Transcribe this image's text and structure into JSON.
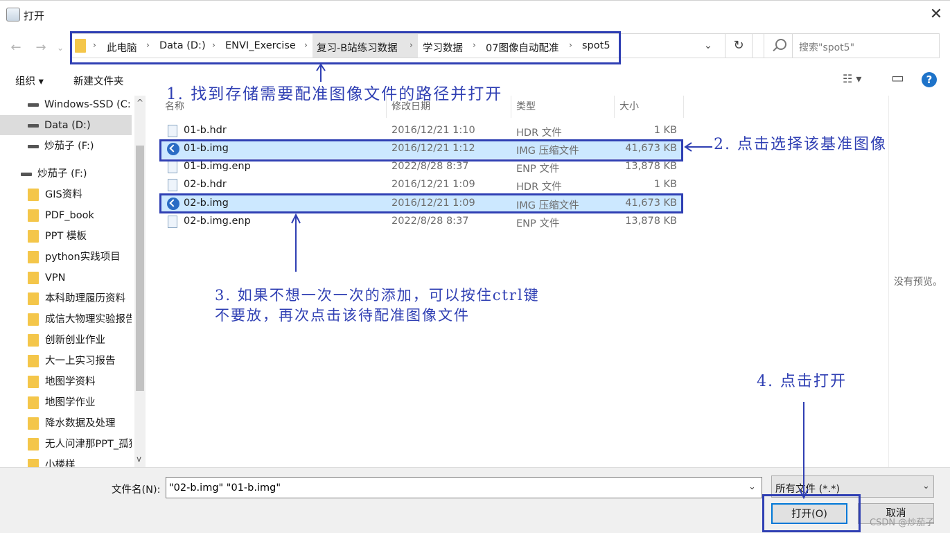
{
  "window": {
    "title": "打开",
    "close_glyph": "✕"
  },
  "nav": {
    "back_glyph": "←",
    "forward_glyph": "→"
  },
  "address": {
    "crumbs": [
      "此电脑",
      "Data (D:)",
      "ENVI_Exercise",
      "复习-B站练习数据",
      "学习数据",
      "07图像自动配准",
      "spot5"
    ],
    "separator": "›",
    "dropdown_glyph": "⌄",
    "refresh_glyph": "↻"
  },
  "search": {
    "placeholder": "搜索\"spot5\""
  },
  "toolbar": {
    "organize": "组织 ▾",
    "new_folder": "新建文件夹",
    "view_glyph": "☷ ▾",
    "pane_glyph": "▭",
    "help_glyph": "?"
  },
  "sidebar": {
    "drives_top": [
      {
        "label": "Windows-SSD (C:",
        "icon": "drive-icon"
      },
      {
        "label": "Data (D:)",
        "icon": "drive-icon",
        "selected": true
      },
      {
        "label": "炒茄子 (F:)",
        "icon": "drive-icon"
      }
    ],
    "drive_header": "炒茄子 (F:)",
    "folders": [
      "GIS资料",
      "PDF_book",
      "PPT 模板",
      "python实践项目",
      "VPN",
      "本科助理履历资料",
      "成信大物理实验报告",
      "创新创业作业",
      "大一上实习报告",
      "地图学资料",
      "地图学作业",
      "降水数据及处理",
      "无人问津那PPT_孤独",
      "小楼样"
    ],
    "scroll_up": "^",
    "scroll_down": "v"
  },
  "columns": {
    "name": "名称",
    "date": "修改日期",
    "type": "类型",
    "size": "大小"
  },
  "files": [
    {
      "name": "01-b.hdr",
      "date": "2016/12/21 1:10",
      "type": "HDR 文件",
      "size": "1 KB",
      "icon": "document-icon",
      "selected": false
    },
    {
      "name": "01-b.img",
      "date": "2016/12/21 1:12",
      "type": "IMG 压缩文件",
      "size": "41,673 KB",
      "icon": "disc-image-icon",
      "selected": true
    },
    {
      "name": "01-b.img.enp",
      "date": "2022/8/28 8:37",
      "type": "ENP 文件",
      "size": "13,878 KB",
      "icon": "document-icon",
      "selected": false
    },
    {
      "name": "02-b.hdr",
      "date": "2016/12/21 1:09",
      "type": "HDR 文件",
      "size": "1 KB",
      "icon": "document-icon",
      "selected": false
    },
    {
      "name": "02-b.img",
      "date": "2016/12/21 1:09",
      "type": "IMG 压缩文件",
      "size": "41,673 KB",
      "icon": "disc-image-icon",
      "selected": true
    },
    {
      "name": "02-b.img.enp",
      "date": "2022/8/28 8:37",
      "type": "ENP 文件",
      "size": "13,878 KB",
      "icon": "document-icon",
      "selected": false
    }
  ],
  "preview": {
    "empty_text": "没有预览。"
  },
  "bottom": {
    "filename_label": "文件名(N):",
    "filename_value": "\"02-b.img\" \"01-b.img\"",
    "filetype_value": "所有文件 (*.*)",
    "dropdown_glyph": "⌄",
    "open_button": "打开(O)",
    "cancel_button": "取消"
  },
  "annotations": {
    "step1": "1. 找到存储需要配准图像文件的路径并打开",
    "step2": "2. 点击选择该基准图像",
    "step3_line1": "3. 如果不想一次一次的添加，可以按住ctrl键",
    "step3_line2": "不要放，再次点击该待配准图像文件",
    "step4": "4. 点击打开",
    "color": "#2f3fb3"
  },
  "watermark": "CSDN @炒茄子",
  "colors": {
    "selection": "#cce8ff",
    "accent": "#0078d7",
    "folder": "#f4c64a"
  }
}
